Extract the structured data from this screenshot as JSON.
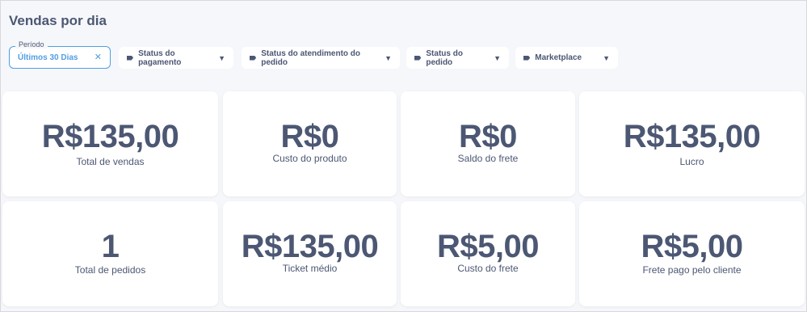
{
  "page": {
    "title": "Vendas por dia"
  },
  "filters": {
    "period": {
      "label": "Período",
      "value": "Últimos 30 Dias",
      "clear_icon": "✕"
    },
    "buttons": [
      {
        "label": "Status do pagamento"
      },
      {
        "label": "Status do atendimento do pedido"
      },
      {
        "label": "Status do pedido"
      },
      {
        "label": "Marketplace"
      }
    ]
  },
  "cards": [
    {
      "value": "R$135,00",
      "label": "Total de vendas"
    },
    {
      "value": "R$0",
      "label": "Custo do produto"
    },
    {
      "value": "R$0",
      "label": "Saldo do frete"
    },
    {
      "value": "R$135,00",
      "label": "Lucro"
    },
    {
      "value": "1",
      "label": "Total de pedidos"
    },
    {
      "value": "R$135,00",
      "label": "Ticket médio"
    },
    {
      "value": "R$5,00",
      "label": "Custo do frete"
    },
    {
      "value": "R$5,00",
      "label": "Frete pago pelo cliente"
    }
  ],
  "colors": {
    "accent": "#509ee3",
    "text": "#4c5773",
    "background": "#f5f7fa"
  }
}
